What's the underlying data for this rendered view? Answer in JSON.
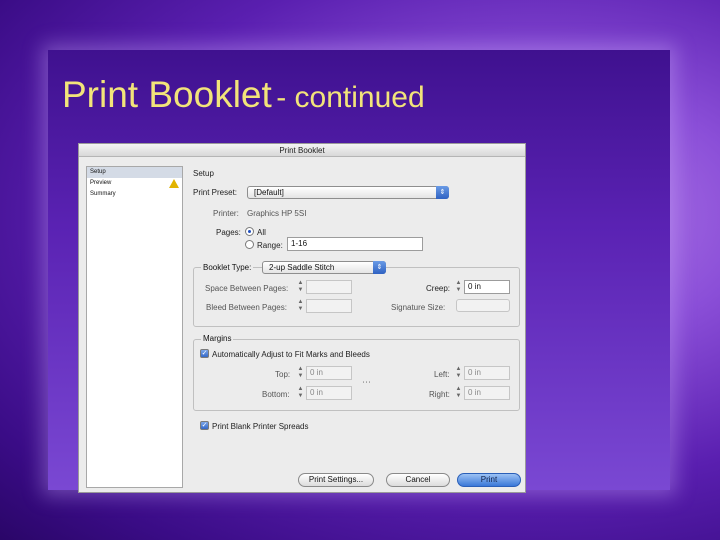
{
  "slide": {
    "title_main": "Print Booklet",
    "title_sub": "- continued",
    "title_color": "#f2e47a"
  },
  "dialog": {
    "window_title": "Print Booklet",
    "nav_items": [
      {
        "label": "Setup",
        "selected": true
      },
      {
        "label": "Preview",
        "warning": true
      },
      {
        "label": "Summary"
      }
    ],
    "section_heading": "Setup",
    "print_preset_label": "Print Preset:",
    "print_preset_value": "[Default]",
    "printer_label": "Printer:",
    "printer_value": "Graphics HP 5SI",
    "pages_label": "Pages:",
    "pages_all_label": "All",
    "pages_range_label": "Range:",
    "pages_range_value": "1-16",
    "booklet_type_label": "Booklet Type:",
    "booklet_type_value": "2-up Saddle Stitch",
    "space_between_label": "Space Between Pages:",
    "bleed_between_label": "Bleed Between Pages:",
    "creep_label": "Creep:",
    "creep_value": "0 in",
    "signature_label": "Signature Size:",
    "margins_label": "Margins",
    "auto_adjust_label": "Automatically Adjust to Fit Marks and Bleeds",
    "top_label": "Top:",
    "top_value": "0 in",
    "bottom_label": "Bottom:",
    "bottom_value": "0 in",
    "left_label": "Left:",
    "left_value": "0 in",
    "right_label": "Right:",
    "right_value": "0 in",
    "blank_spreads_label": "Print Blank Printer Spreads",
    "print_settings_button": "Print Settings...",
    "cancel_button": "Cancel",
    "print_button": "Print"
  }
}
